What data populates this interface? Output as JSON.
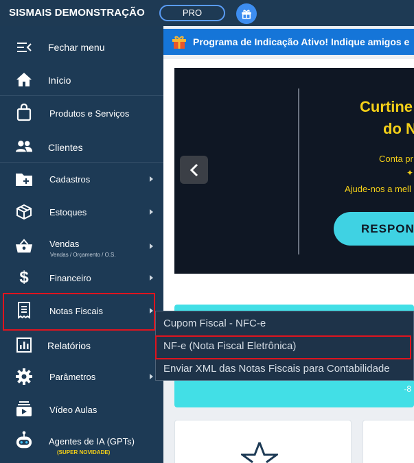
{
  "header": {
    "brand": "SISMAIS DEMONSTRAÇÃO",
    "plan_badge": "PRO"
  },
  "sidebar": {
    "items": [
      {
        "label": "Fechar menu",
        "icon": "collapse-menu-icon"
      },
      {
        "label": "Início",
        "icon": "home-icon"
      },
      {
        "label": "Produtos e Serviços",
        "icon": "shopping-bag-icon"
      },
      {
        "label": "Clientes",
        "icon": "people-icon"
      },
      {
        "label": "Cadastros",
        "icon": "folder-add-icon"
      },
      {
        "label": "Estoques",
        "icon": "box-icon"
      },
      {
        "label": "Vendas",
        "sublabel": "Vendas / Orçamento / O.S.",
        "icon": "basket-icon"
      },
      {
        "label": "Financeiro",
        "icon": "dollar-icon"
      },
      {
        "label": "Notas Fiscais",
        "icon": "receipt-icon"
      },
      {
        "label": "Relatórios",
        "icon": "bar-chart-icon"
      },
      {
        "label": "Parâmetros",
        "icon": "gear-icon"
      },
      {
        "label": "Vídeo Aulas",
        "icon": "video-library-icon"
      },
      {
        "label": "Agentes de IA (GPTs)",
        "sublabel": "(SUPER NOVIDADE)",
        "icon": "robot-icon"
      }
    ]
  },
  "banner": {
    "text": "Programa de Indicação Ativo! Indique amigos e"
  },
  "carousel": {
    "title_line1": "Curtine",
    "title_line2": "do N",
    "subtitle_line1": "Conta pr",
    "subtitle_line2": "Ajude-nos a mell",
    "button_label": "RESPON"
  },
  "cyan_card": {
    "value": "-8"
  },
  "submenu": {
    "items": [
      "Cupom Fiscal - NFC-e",
      "NF-e (Nota Fiscal Eletrônica)",
      "Enviar XML das Notas Fiscais para Contabilidade"
    ]
  },
  "colors": {
    "sidebar_bg": "#1d3a55",
    "header_bg": "#1e3a54",
    "banner_bg": "#1575d8",
    "highlight_red": "#e0141e",
    "carousel_yellow": "#f4d018",
    "cyan": "#42dfe6"
  }
}
